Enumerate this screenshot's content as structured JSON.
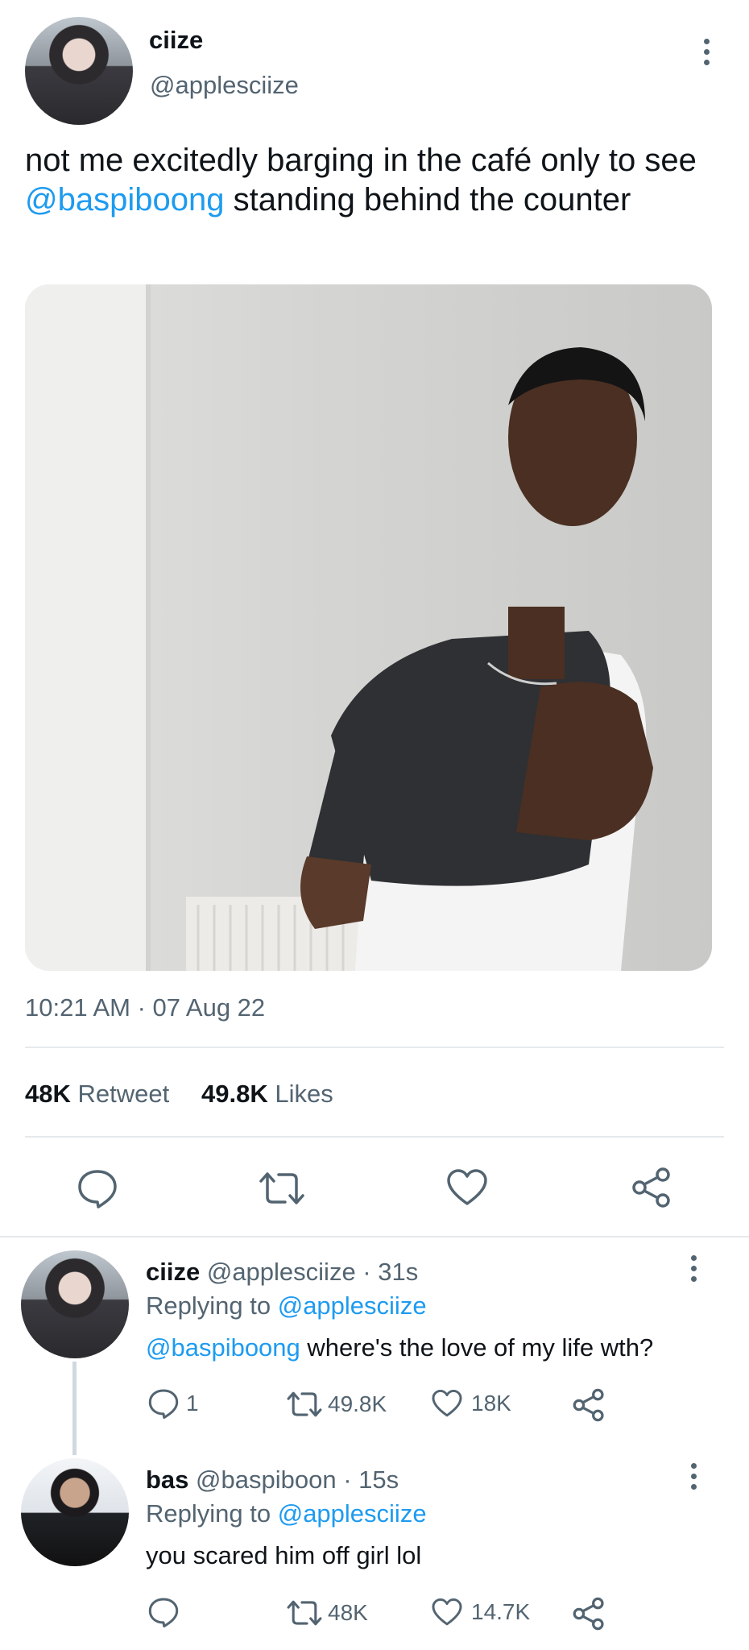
{
  "tweet": {
    "display_name": "ciize",
    "handle": "@applesciize",
    "text_before": "not me excitedly barging in the café only to see ",
    "mention": "@baspiboong",
    "text_after": " standing behind the counter",
    "time": "10:21 AM · 07 Aug 22",
    "retweets_count": "48K",
    "retweets_label": "Retweet",
    "likes_count": "49.8K",
    "likes_label": "Likes"
  },
  "replies": [
    {
      "display_name": "ciize",
      "handle_time": "@applesciize · 31s",
      "replying_prefix": "Replying to",
      "replying_to": "@applesciize",
      "mention": "@baspiboong",
      "text": " where's the love of my life wth?",
      "reply_count": "1",
      "retweet_count": "49.8K",
      "like_count": "18K"
    },
    {
      "display_name": "bas",
      "handle_time": "@baspiboon · 15s",
      "replying_prefix": "Replying to",
      "replying_to": "@applesciize",
      "text": "you scared him off girl lol",
      "retweet_count": "48K",
      "like_count": "14.7K"
    }
  ],
  "colors": {
    "link": "#1d9bf0",
    "secondary_text": "#536471",
    "divider": "#e6e9ec"
  }
}
